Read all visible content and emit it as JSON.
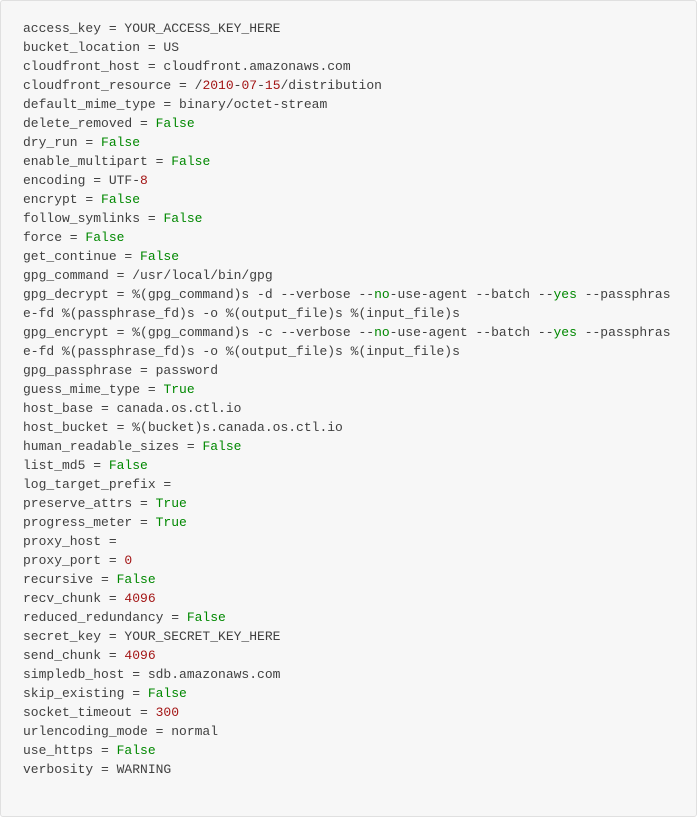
{
  "lines": [
    [
      {
        "t": "access_key = YOUR_ACCESS_KEY_HERE",
        "c": ""
      }
    ],
    [
      {
        "t": "bucket_location = US",
        "c": ""
      }
    ],
    [
      {
        "t": "cloudfront_host = cloudfront.amazonaws.com",
        "c": ""
      }
    ],
    [
      {
        "t": "cloudfront_resource = /",
        "c": ""
      },
      {
        "t": "2010",
        "c": "num"
      },
      {
        "t": "-",
        "c": ""
      },
      {
        "t": "07",
        "c": "num"
      },
      {
        "t": "-",
        "c": ""
      },
      {
        "t": "15",
        "c": "num"
      },
      {
        "t": "/distribution",
        "c": ""
      }
    ],
    [
      {
        "t": "default_mime_type = binary/octet-stream",
        "c": ""
      }
    ],
    [
      {
        "t": "delete_removed = ",
        "c": ""
      },
      {
        "t": "False",
        "c": "kw"
      }
    ],
    [
      {
        "t": "dry_run = ",
        "c": ""
      },
      {
        "t": "False",
        "c": "kw"
      }
    ],
    [
      {
        "t": "enable_multipart = ",
        "c": ""
      },
      {
        "t": "False",
        "c": "kw"
      }
    ],
    [
      {
        "t": "encoding = UTF-",
        "c": ""
      },
      {
        "t": "8",
        "c": "num"
      }
    ],
    [
      {
        "t": "encrypt = ",
        "c": ""
      },
      {
        "t": "False",
        "c": "kw"
      }
    ],
    [
      {
        "t": "follow_symlinks = ",
        "c": ""
      },
      {
        "t": "False",
        "c": "kw"
      }
    ],
    [
      {
        "t": "force = ",
        "c": ""
      },
      {
        "t": "False",
        "c": "kw"
      }
    ],
    [
      {
        "t": "get_continue = ",
        "c": ""
      },
      {
        "t": "False",
        "c": "kw"
      }
    ],
    [
      {
        "t": "gpg_command = /usr/local/bin/gpg",
        "c": ""
      }
    ],
    [
      {
        "t": "gpg_decrypt = %(gpg_command)s -d --verbose --",
        "c": ""
      },
      {
        "t": "no",
        "c": "kw"
      },
      {
        "t": "-use-agent --batch --",
        "c": ""
      },
      {
        "t": "yes",
        "c": "kw"
      },
      {
        "t": " --passphrase-fd %(passphrase_fd)s -o %(output_file)s %(input_file)s",
        "c": ""
      }
    ],
    [
      {
        "t": "gpg_encrypt = %(gpg_command)s -c --verbose --",
        "c": ""
      },
      {
        "t": "no",
        "c": "kw"
      },
      {
        "t": "-use-agent --batch --",
        "c": ""
      },
      {
        "t": "yes",
        "c": "kw"
      },
      {
        "t": " --passphrase-fd %(passphrase_fd)s -o %(output_file)s %(input_file)s",
        "c": ""
      }
    ],
    [
      {
        "t": "gpg_passphrase = password",
        "c": ""
      }
    ],
    [
      {
        "t": "guess_mime_type = ",
        "c": ""
      },
      {
        "t": "True",
        "c": "kw"
      }
    ],
    [
      {
        "t": "host_base = canada.os.ctl.io",
        "c": ""
      }
    ],
    [
      {
        "t": "host_bucket = %(bucket)s.canada.os.ctl.io",
        "c": ""
      }
    ],
    [
      {
        "t": "human_readable_sizes = ",
        "c": ""
      },
      {
        "t": "False",
        "c": "kw"
      }
    ],
    [
      {
        "t": "list_md5 = ",
        "c": ""
      },
      {
        "t": "False",
        "c": "kw"
      }
    ],
    [
      {
        "t": "log_target_prefix =",
        "c": ""
      }
    ],
    [
      {
        "t": "preserve_attrs = ",
        "c": ""
      },
      {
        "t": "True",
        "c": "kw"
      }
    ],
    [
      {
        "t": "progress_meter = ",
        "c": ""
      },
      {
        "t": "True",
        "c": "kw"
      }
    ],
    [
      {
        "t": "proxy_host =",
        "c": ""
      }
    ],
    [
      {
        "t": "proxy_port = ",
        "c": ""
      },
      {
        "t": "0",
        "c": "num"
      }
    ],
    [
      {
        "t": "recursive = ",
        "c": ""
      },
      {
        "t": "False",
        "c": "kw"
      }
    ],
    [
      {
        "t": "recv_chunk = ",
        "c": ""
      },
      {
        "t": "4096",
        "c": "num"
      }
    ],
    [
      {
        "t": "reduced_redundancy = ",
        "c": ""
      },
      {
        "t": "False",
        "c": "kw"
      }
    ],
    [
      {
        "t": "secret_key = YOUR_SECRET_KEY_HERE",
        "c": ""
      }
    ],
    [
      {
        "t": "send_chunk = ",
        "c": ""
      },
      {
        "t": "4096",
        "c": "num"
      }
    ],
    [
      {
        "t": "simpledb_host = sdb.amazonaws.com",
        "c": ""
      }
    ],
    [
      {
        "t": "skip_existing = ",
        "c": ""
      },
      {
        "t": "False",
        "c": "kw"
      }
    ],
    [
      {
        "t": "socket_timeout = ",
        "c": ""
      },
      {
        "t": "300",
        "c": "num"
      }
    ],
    [
      {
        "t": "urlencoding_mode = normal",
        "c": ""
      }
    ],
    [
      {
        "t": "use_https = ",
        "c": ""
      },
      {
        "t": "False",
        "c": "kw"
      }
    ],
    [
      {
        "t": "verbosity = WARNING",
        "c": ""
      }
    ]
  ]
}
